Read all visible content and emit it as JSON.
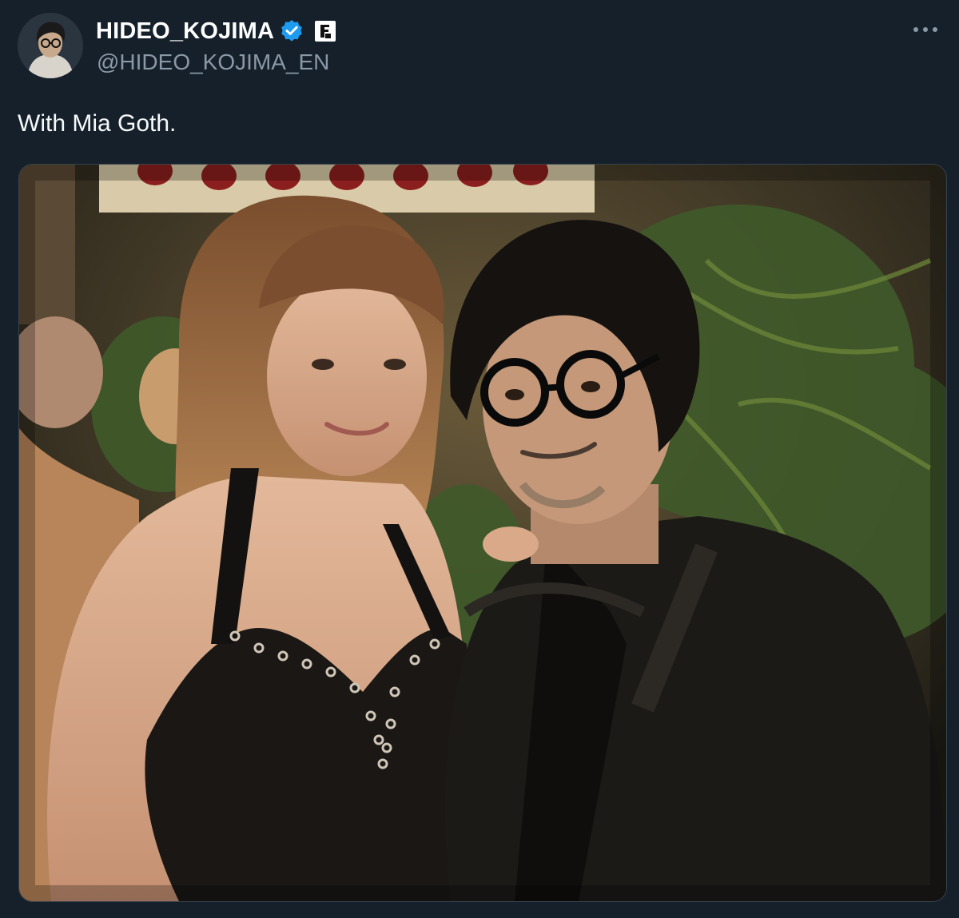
{
  "author": {
    "display_name": "HIDEO_KOJIMA",
    "handle": "@HIDEO_KOJIMA_EN",
    "verified_icon": "verified-badge-icon",
    "affiliation_icon": "affiliate-badge-icon"
  },
  "tweet": {
    "text": "With Mia Goth."
  },
  "icons": {
    "more": "more-options-icon"
  },
  "colors": {
    "background": "#15202b",
    "secondary_text": "#8b98a5",
    "verified_blue": "#1d9bf0"
  }
}
